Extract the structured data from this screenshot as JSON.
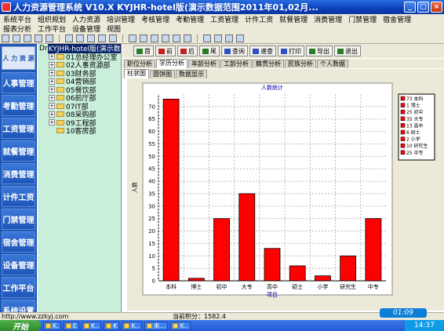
{
  "window": {
    "title": "人力资源管理系统  V10.X    KYJHR-hotel版(演示数据范围2011年01,02月..."
  },
  "menu1": [
    "系统平台",
    "组织规划",
    "人力资源",
    "培训管理",
    "考核管理",
    "考勤管理",
    "工资管理",
    "计件工资",
    "就餐管理",
    "消费管理",
    "门禁管理",
    "宿舍管理"
  ],
  "menu2": [
    "报表分析",
    "工作平台",
    "设备管理",
    "视图"
  ],
  "sidebar": {
    "logo": "人 力 资 源",
    "items": [
      "人事管理",
      "考勤管理",
      "工资管理",
      "就餐管理",
      "消费管理",
      "计件工资",
      "门禁管理",
      "宿舍管理",
      "设备管理",
      "工作平台",
      "系统设置"
    ]
  },
  "tree": {
    "root_prefix": "Dr",
    "root": "KYJHR-hotel版(演示数",
    "nodes": [
      "01总经理办公室",
      "02人事资源部",
      "03财务部",
      "04营销部",
      "05餐饮部",
      "06前厅部",
      "07IT部",
      "08采购部",
      "09工程部",
      "10客房部"
    ]
  },
  "toolbar": {
    "first": "首",
    "prev": "前",
    "next": "后",
    "last": "尾",
    "query": "查询",
    "quick_query": "速查",
    "print": "打印",
    "export": "导出",
    "exit": "退出"
  },
  "tabs": [
    "职位分析",
    "学历分析",
    "年龄分析",
    "工龄分析",
    "籍贯分析",
    "民族分析",
    "个人数据"
  ],
  "active_tab": "学历分析",
  "subtabs": [
    "柱状图",
    "圆饼图",
    "数据显示"
  ],
  "chart_data": {
    "type": "bar",
    "title": "人数统计",
    "xlabel": "项目",
    "ylabel": "人数",
    "categories": [
      "本科",
      "博士",
      "初中",
      "大专",
      "高中",
      "硕士",
      "小学",
      "研究生",
      "中专"
    ],
    "values": [
      73,
      1,
      25,
      35,
      13,
      6,
      2,
      10,
      25
    ],
    "ylim": [
      0,
      75
    ],
    "yticks": [
      0,
      5,
      10,
      15,
      20,
      25,
      30,
      35,
      40,
      45,
      50,
      55,
      60,
      65,
      70
    ],
    "legend": [
      "73 本科",
      "1 博士",
      "25 初中",
      "35 大专",
      "13 高中",
      "6 硕士",
      "2 小学",
      "10 研究生",
      "25 中专"
    ],
    "legend_position": "right",
    "grid": true,
    "bar_color": "#ff0000"
  },
  "status": {
    "url": "http://www.zzkyj.com",
    "score": "当前积分：1582.4"
  },
  "taskbar": {
    "start": "开始",
    "items": [
      "K.",
      "E",
      "K..",
      "K",
      "K..",
      "未...",
      "K.."
    ],
    "time": "14:37"
  },
  "clock": "01:09"
}
